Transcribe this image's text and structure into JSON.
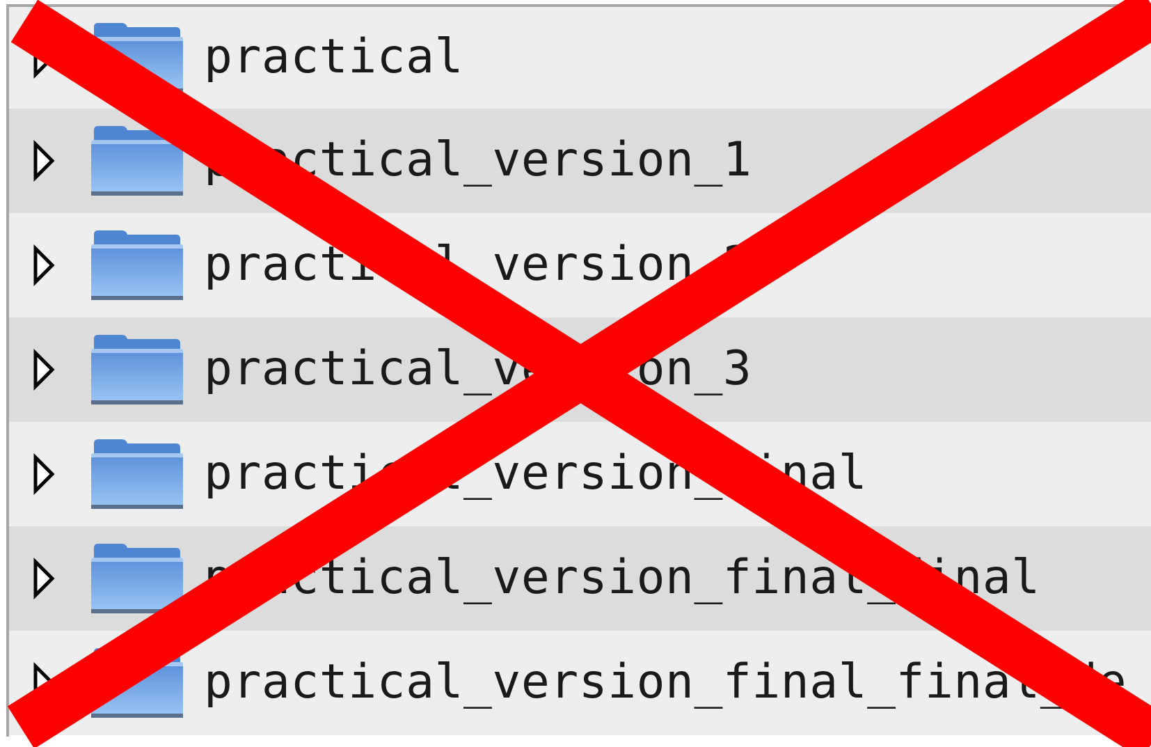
{
  "file_tree": {
    "items": [
      {
        "name": "practical",
        "expander_icon": "triangle-right-icon",
        "icon": "folder-icon"
      },
      {
        "name": "practical_version_1",
        "expander_icon": "triangle-right-icon",
        "icon": "folder-icon"
      },
      {
        "name": "practical_version_2",
        "expander_icon": "triangle-right-icon",
        "icon": "folder-icon"
      },
      {
        "name": "practical_version_3",
        "expander_icon": "triangle-right-icon",
        "icon": "folder-icon"
      },
      {
        "name": "practical_version_final",
        "expander_icon": "triangle-right-icon",
        "icon": "folder-icon"
      },
      {
        "name": "practical_version_final_final",
        "expander_icon": "triangle-right-icon",
        "icon": "folder-icon"
      },
      {
        "name": "practical_version_final_final_de_verdad",
        "expander_icon": "triangle-right-icon",
        "icon": "folder-icon"
      }
    ]
  },
  "overlay": {
    "icon": "red-x-cross-icon",
    "color": "#ff0000"
  },
  "colors": {
    "row_light": "#eeeeee",
    "row_dark": "#dcdcdc",
    "folder_blue": "#6fa6ea",
    "border": "#a8a6a4"
  }
}
